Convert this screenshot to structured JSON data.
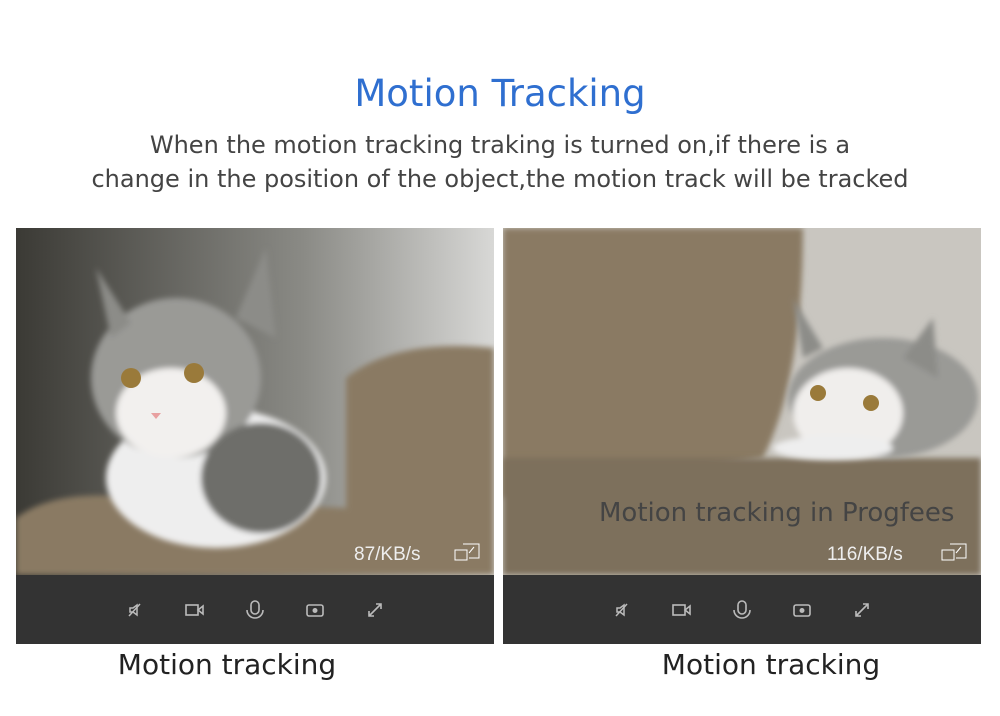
{
  "title": "Motion Tracking",
  "description_line1": "When the motion tracking traking is turned on,if there is a",
  "description_line2": "change in the position of the object,the motion track will be tracked",
  "panels": [
    {
      "rate": "87/KB/s",
      "caption": "Motion tracking"
    },
    {
      "rate": "116/KB/s",
      "caption": "Motion tracking",
      "overlay": "Motion tracking in Progfees"
    }
  ],
  "controls": [
    "mute-icon",
    "video-record-icon",
    "microphone-icon",
    "snapshot-icon",
    "fullscreen-icon"
  ],
  "colors": {
    "title": "#2f6fd0",
    "control_bar": "#333333"
  }
}
